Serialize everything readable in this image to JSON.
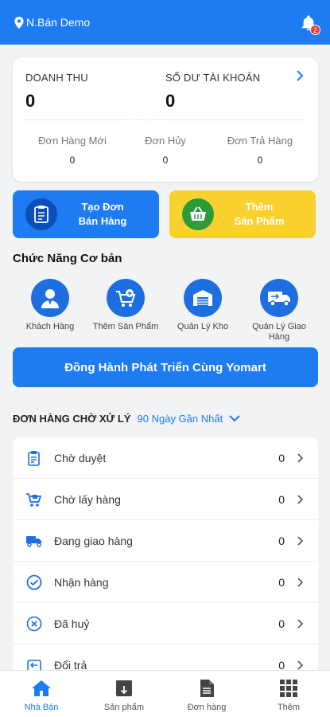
{
  "header": {
    "location_icon": "location-pin-icon",
    "store_name": "N.Bán Demo",
    "notification_icon": "bell-icon",
    "notification_count": "2"
  },
  "summary": {
    "revenue_label": "DOANH THU",
    "revenue_value": "0",
    "balance_label": "SỐ DƯ TÀI KHOẢN",
    "balance_value": "0",
    "stats": [
      {
        "label": "Đơn Hàng Mới",
        "value": "0"
      },
      {
        "label": "Đơn Hủy",
        "value": "0"
      },
      {
        "label": "Đơn Trả Hàng",
        "value": "0"
      }
    ]
  },
  "actions": {
    "create_order": "Tạo Đơn\nBán Hàng",
    "add_product": "Thêm\nSản Phẩm"
  },
  "features": {
    "title": "Chức Năng Cơ bản",
    "items": [
      {
        "label": "Khách Hàng",
        "icon": "customer-icon"
      },
      {
        "label": "Thêm Sản Phẩm",
        "icon": "add-cart-icon"
      },
      {
        "label": "Quản Lý Kho",
        "icon": "warehouse-icon"
      },
      {
        "label": "Quản Lý Giao Hàng",
        "icon": "delivery-truck-icon"
      }
    ]
  },
  "partner_button": "Đồng Hành Phát Triển Cùng Yomart",
  "pending": {
    "title": "ĐƠN HÀNG CHỜ XỬ LÝ",
    "filter": "90 Ngày Gần Nhất",
    "rows": [
      {
        "label": "Chờ duyệt",
        "count": "0",
        "icon": "clipboard-icon"
      },
      {
        "label": "Chờ lấy hàng",
        "count": "0",
        "icon": "cart-pickup-icon"
      },
      {
        "label": "Đang giao hàng",
        "count": "0",
        "icon": "truck-icon"
      },
      {
        "label": "Nhận hàng",
        "count": "0",
        "icon": "check-circle-icon"
      },
      {
        "label": "Đã huỷ",
        "count": "0",
        "icon": "cancel-circle-icon"
      },
      {
        "label": "Đổi trả",
        "count": "0",
        "icon": "return-icon"
      }
    ]
  },
  "tabs": [
    {
      "label": "Nhà Bán",
      "icon": "home-icon",
      "active": true
    },
    {
      "label": "Sản phẩm",
      "icon": "product-box-icon",
      "active": false
    },
    {
      "label": "Đơn hàng",
      "icon": "document-icon",
      "active": false
    },
    {
      "label": "Thêm",
      "icon": "grid-icon",
      "active": false
    }
  ],
  "colors": {
    "primary": "#1d7cf2",
    "yellow": "#f8d12e",
    "green": "#2e9b3b",
    "badge": "#e53935"
  }
}
